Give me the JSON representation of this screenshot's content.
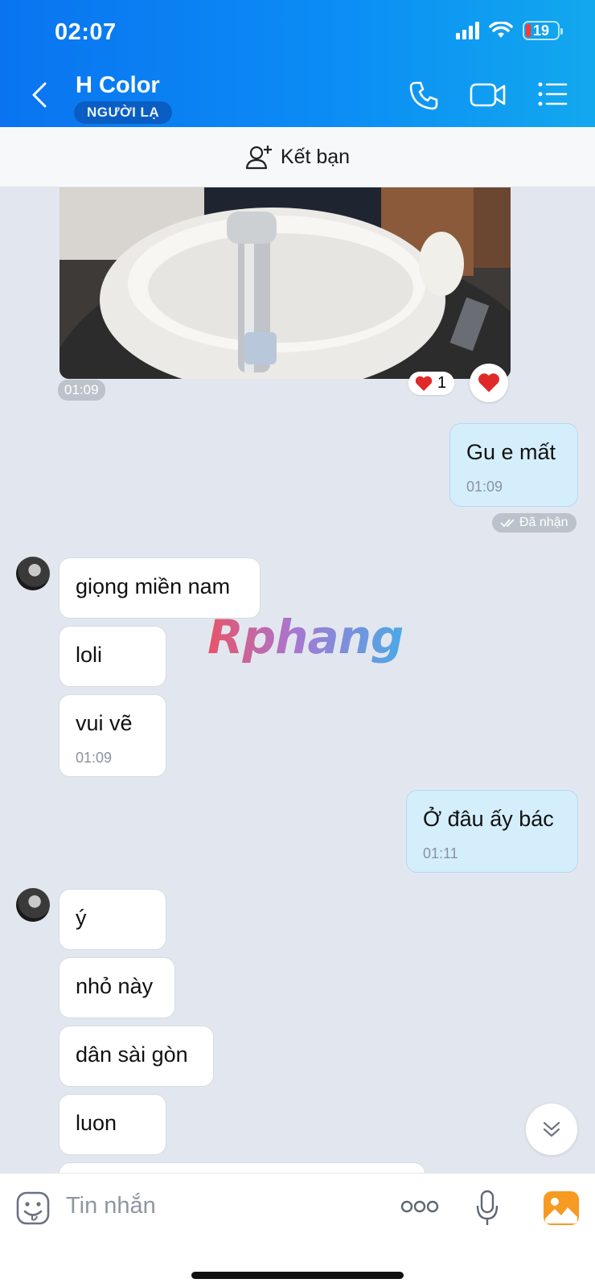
{
  "status_bar": {
    "time": "02:07",
    "battery": "19"
  },
  "header": {
    "title": "H Color",
    "badge": "NGƯỜI LẠ"
  },
  "friend_bar": {
    "label": "Kết bạn"
  },
  "photo_message": {
    "time": "01:09",
    "reaction_count": "1"
  },
  "messages": [
    {
      "side": "out",
      "text": "Gu e mất",
      "time": "01:09",
      "status": "Đã nhận"
    },
    {
      "side": "in",
      "text": "giọng miền nam"
    },
    {
      "side": "in",
      "text": "loli"
    },
    {
      "side": "in",
      "text": "vui vẽ",
      "time": "01:09"
    },
    {
      "side": "out",
      "text": "Ở đâu ấy bác",
      "time": "01:11"
    },
    {
      "side": "in",
      "text": "ý"
    },
    {
      "side": "in",
      "text": "nhỏ này"
    },
    {
      "side": "in",
      "text": "dân sài gòn"
    },
    {
      "side": "in",
      "text": "luon"
    }
  ],
  "watermark": "Rphang",
  "composer": {
    "placeholder": "Tin nhắn"
  },
  "colors": {
    "header_start": "#0a74f0",
    "header_end": "#12a8ee",
    "chat_bg": "#e2e7ef",
    "outgoing_bubble": "#d5eefc",
    "incoming_bubble": "#ffffff"
  }
}
